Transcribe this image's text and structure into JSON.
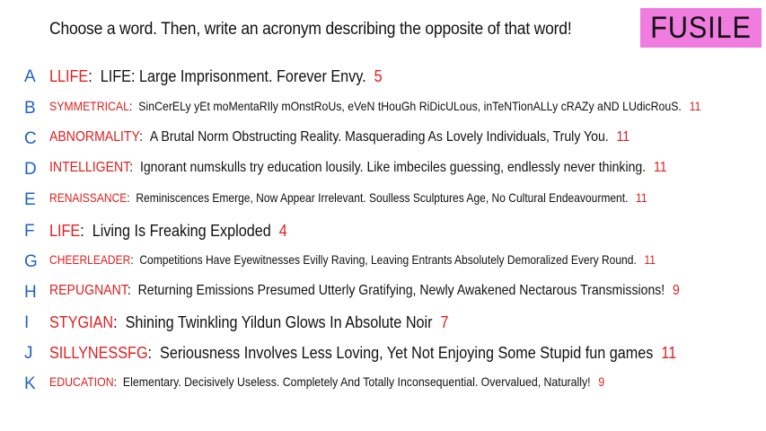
{
  "prompt": "Choose a word. Then, write an acronym describing the opposite of that word!",
  "badge": "FUSILE",
  "items": [
    {
      "letter": "A",
      "word": "LLIFE",
      "definition": "LIFE: Large Imprisonment. Forever Envy.",
      "count": "5"
    },
    {
      "letter": "B",
      "word": "SYMMETRICAL",
      "definition": "SinCerELy yEt moMentaRIly mOnstRoUs, eVeN tHouGh RiDicULous, inTeNTionALLy cRAZy aND LUdicRouS.",
      "count": "11"
    },
    {
      "letter": "C",
      "word": "ABNORMALITY",
      "definition": "A Brutal Norm Obstructing Reality. Masquerading As Lovely Individuals, Truly You.",
      "count": "11"
    },
    {
      "letter": "D",
      "word": "INTELLIGENT",
      "definition": "Ignorant numskulls try education lousily. Like imbeciles guessing, endlessly never thinking.",
      "count": "11"
    },
    {
      "letter": "E",
      "word": "RENAISSANCE",
      "definition": "Reminiscences Emerge, Now Appear Irrelevant. Soulless Sculptures Age, No Cultural Endeavourment.",
      "count": "11"
    },
    {
      "letter": "F",
      "word": "LIFE",
      "definition": "Living Is Freaking Exploded",
      "count": "4"
    },
    {
      "letter": "G",
      "word": "CHEERLEADER",
      "definition": "Competitions Have Eyewitnesses Evilly Raving, Leaving Entrants Absolutely Demoralized Every Round.",
      "count": "11"
    },
    {
      "letter": "H",
      "word": "REPUGNANT",
      "definition": "Returning Emissions Presumed Utterly Gratifying, Newly Awakened Nectarous Transmissions!",
      "count": "9"
    },
    {
      "letter": "I",
      "word": "STYGIAN",
      "definition": "Shining Twinkling Yildun Glows In Absolute Noir",
      "count": "7"
    },
    {
      "letter": "J",
      "word": "SILLYNESSFG",
      "definition": "Seriousness Involves Less Loving, Yet Not Enjoying Some Stupid fun games",
      "count": "11"
    },
    {
      "letter": "K",
      "word": "EDUCATION",
      "definition": "Elementary. Decisively Useless. Completely And Totally Inconsequential. Overvalued, Naturally!",
      "count": "9"
    }
  ]
}
